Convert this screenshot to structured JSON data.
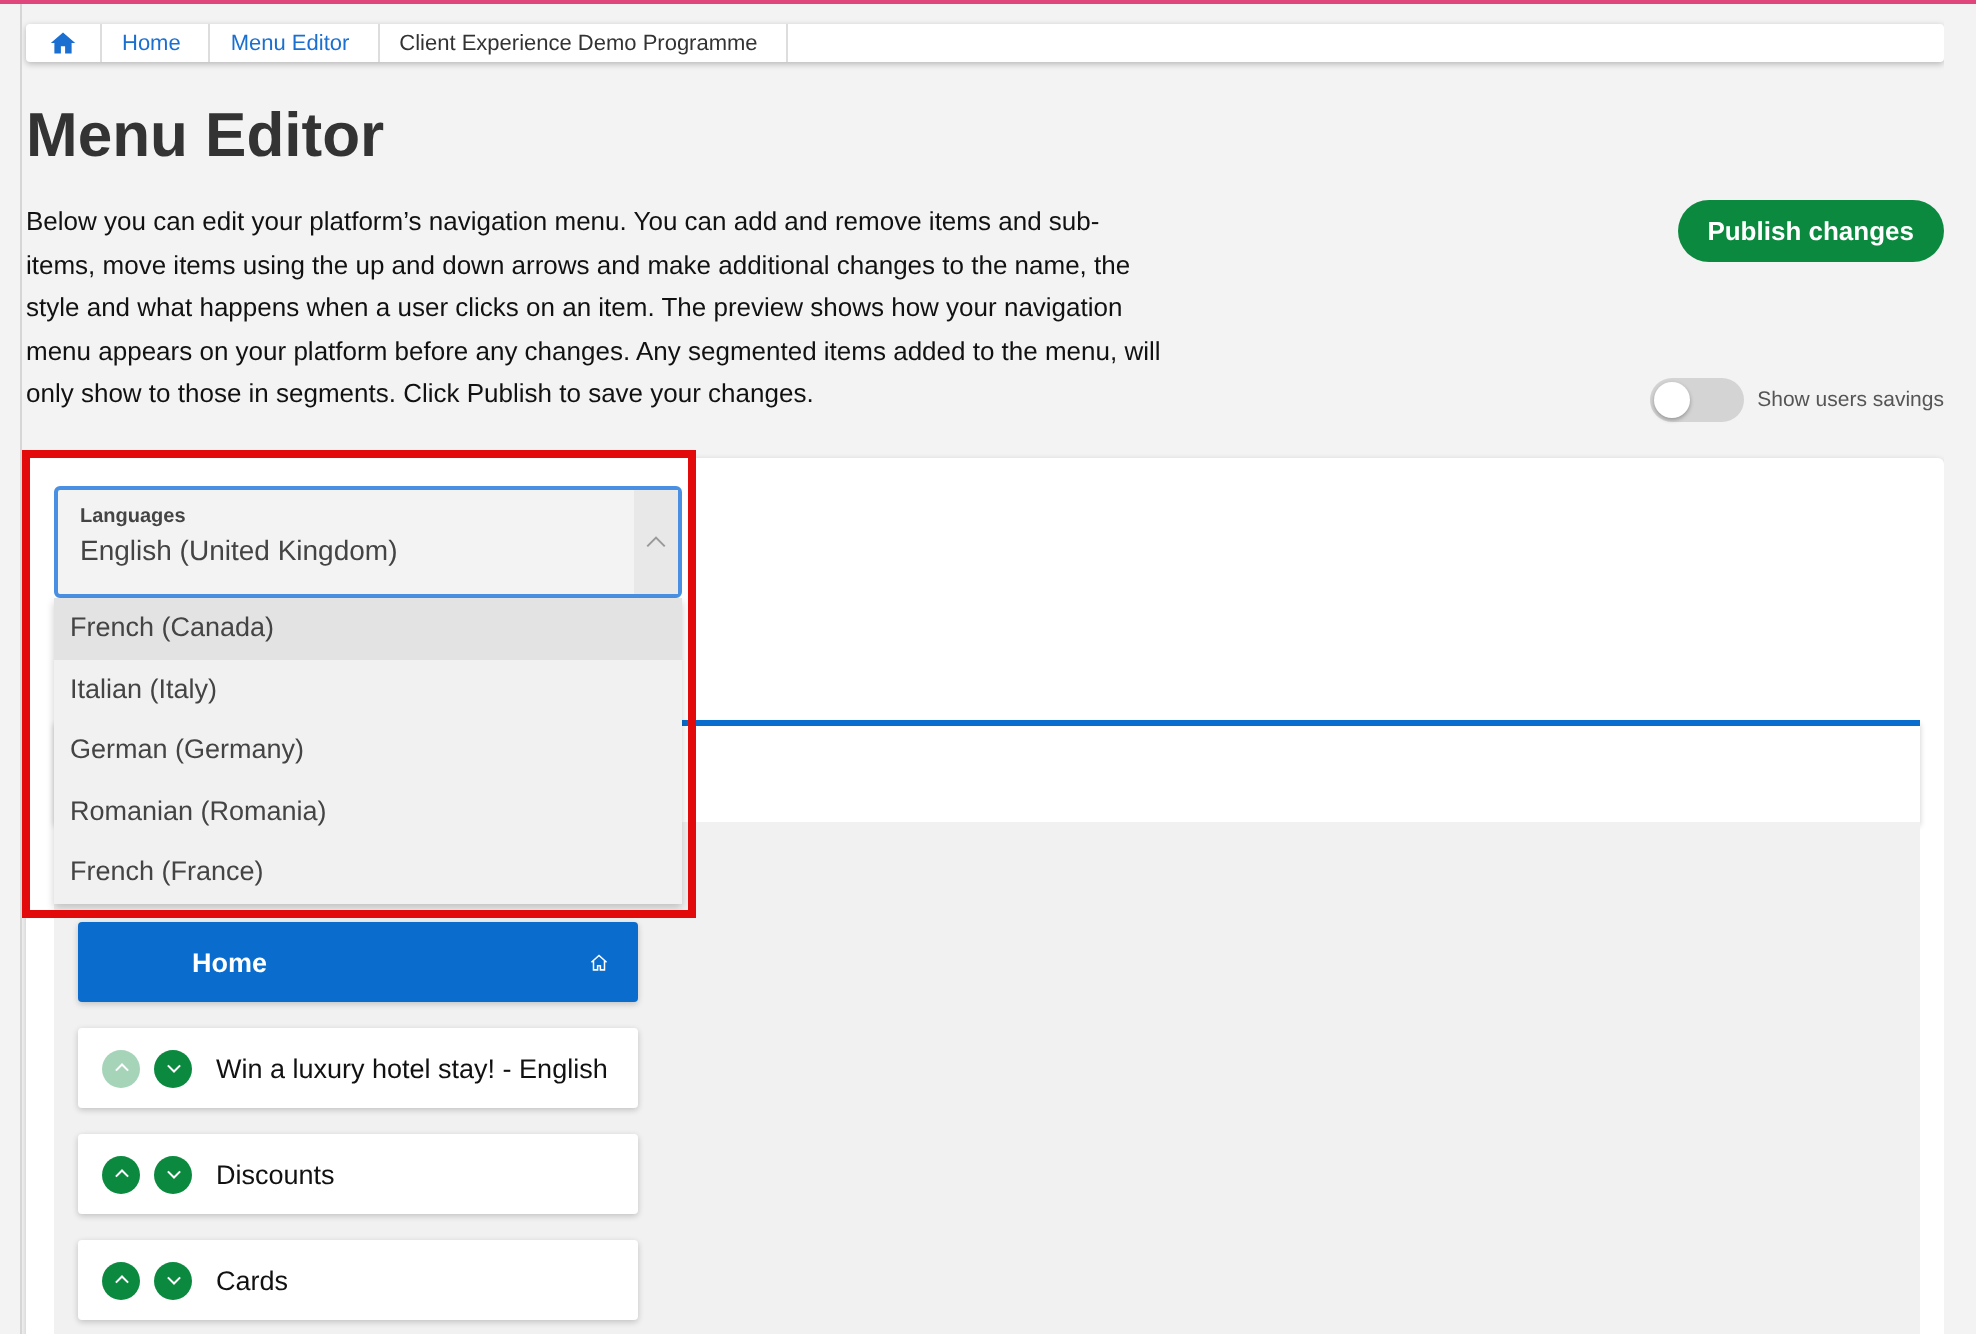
{
  "breadcrumb": [
    {
      "label": "Home",
      "kind": "link"
    },
    {
      "label": "Menu Editor",
      "kind": "link"
    },
    {
      "label": "Client Experience Demo Programme",
      "kind": "current"
    }
  ],
  "title": "Menu Editor",
  "description": "Below you can edit your platform’s navigation menu. You can add and remove items and sub-items, move items using the up and down arrows and make additional changes to the name, the style and what happens when a user clicks on an item. The preview shows how your navigation menu appears on your platform before any changes. Any segmented items added to the menu, will only show to those in segments. Click Publish to save your changes.",
  "publish_button": "Publish changes",
  "savings_toggle": {
    "label": "Show users savings",
    "on": false
  },
  "language_select": {
    "label": "Languages",
    "value": "English (United Kingdom)",
    "expanded": true,
    "highlighted": true,
    "options": [
      {
        "label": "French (Canada)",
        "selected": true
      },
      {
        "label": "Italian (Italy)",
        "selected": false
      },
      {
        "label": "German (Germany)",
        "selected": false
      },
      {
        "label": "Romanian (Romania)",
        "selected": false
      },
      {
        "label": "French (France)",
        "selected": false
      }
    ]
  },
  "menu_items": [
    {
      "label": "Home",
      "kind": "home"
    },
    {
      "label": "Win a luxury hotel stay! - English",
      "kind": "item",
      "up_disabled": true
    },
    {
      "label": "Discounts",
      "kind": "item",
      "up_disabled": false
    },
    {
      "label": "Cards",
      "kind": "item",
      "up_disabled": false
    }
  ]
}
